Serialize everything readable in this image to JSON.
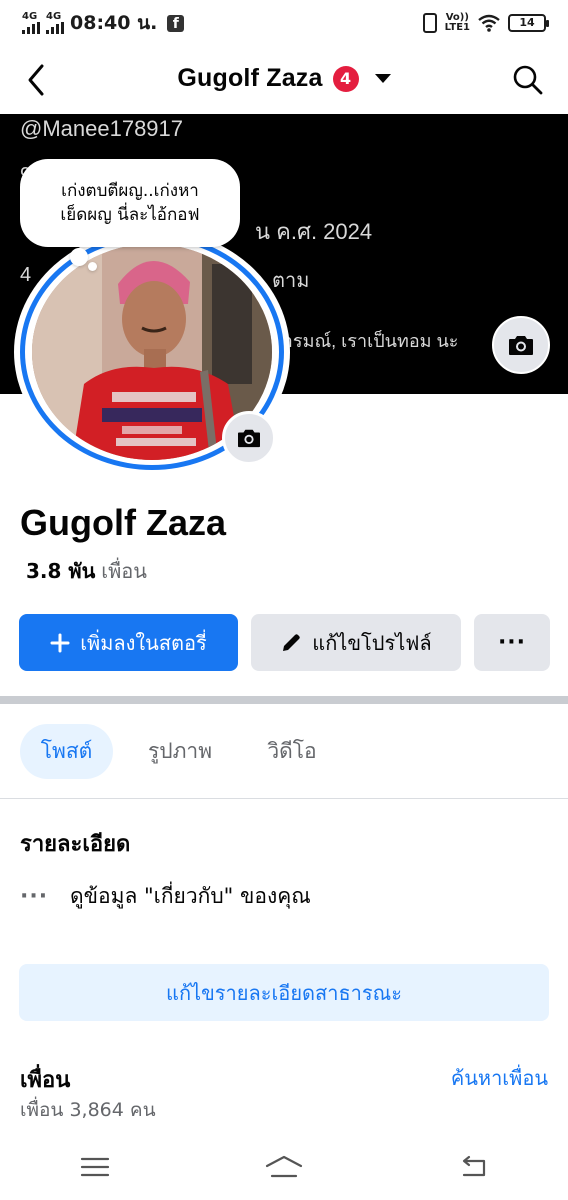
{
  "status_bar": {
    "network1": "4G",
    "network2": "4G",
    "time": "08:40 น.",
    "volte": "Vo))",
    "lte": "LTE1",
    "battery": "14"
  },
  "nav": {
    "title": "Gugolf Zaza",
    "notification_count": "4"
  },
  "cover": {
    "lines": [
      "@Manee178917",
      "น ค.ศ. 2024",
      "ตาม",
      "อารมณ์, เราเป็นทอม นะ"
    ]
  },
  "note": {
    "text_line1": "เก่งตบตีผญ..เก่งหา",
    "text_line2": "เย็ดผญ นี่ละไอ้กอฟ"
  },
  "profile": {
    "name": "Gugolf Zaza",
    "friends_count_short": "3.8 พัน",
    "friends_label": "เพื่อน"
  },
  "actions": {
    "add_story": "เพิ่มลงในสตอรี่",
    "edit_profile": "แก้ไขโปรไฟล์",
    "more": "···"
  },
  "tabs": [
    {
      "label": "โพสต์",
      "active": true
    },
    {
      "label": "รูปภาพ",
      "active": false
    },
    {
      "label": "วิดีโอ",
      "active": false
    }
  ],
  "details": {
    "title": "รายละเอียด",
    "about_link": "ดูข้อมูล \"เกี่ยวกับ\" ของคุณ",
    "edit_public": "แก้ไขรายละเอียดสาธารณะ"
  },
  "friends": {
    "title": "เพื่อน",
    "find": "ค้นหาเพื่อน",
    "count": "เพื่อน 3,864 คน"
  },
  "colors": {
    "accent": "#1877f2",
    "badge": "#e41e3f",
    "secondary_bg": "#e4e6eb",
    "light_blue_bg": "#e7f3ff"
  },
  "icons": {
    "back": "chevron-left-icon",
    "search": "search-icon",
    "camera": "camera-icon",
    "plus": "plus-icon",
    "pencil": "pencil-icon"
  }
}
